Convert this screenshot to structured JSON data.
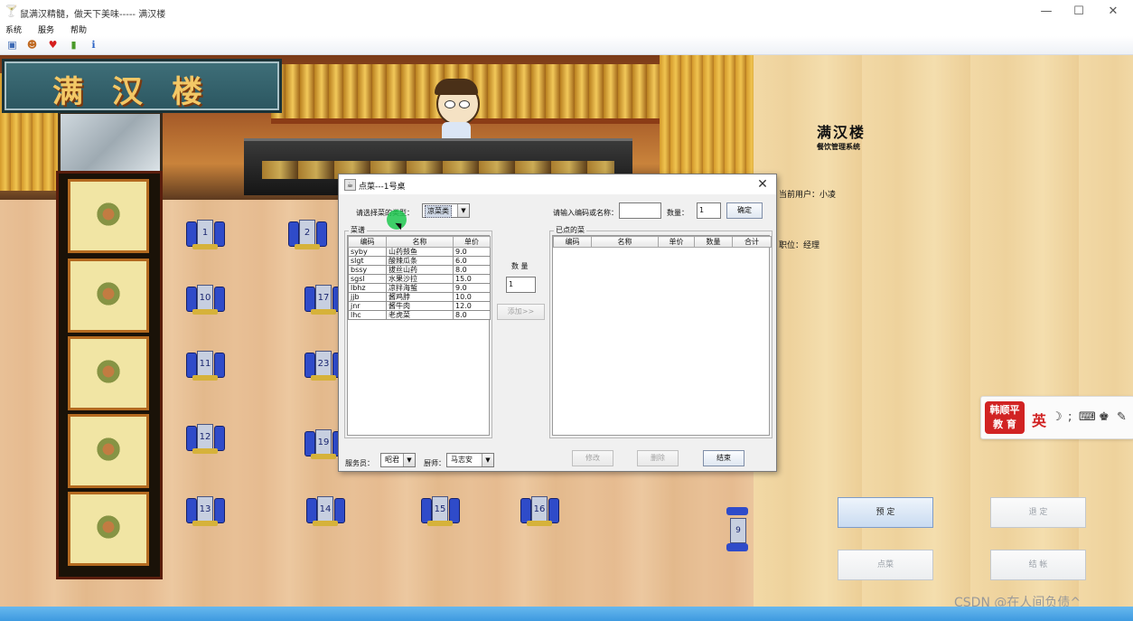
{
  "window": {
    "title": "鼠满汉精髓，做天下美味----- 满汉楼",
    "minimize_glyph": "—",
    "maximize_glyph": "☐",
    "close_glyph": "✕"
  },
  "menu": {
    "items": [
      "系统",
      "服务",
      "帮助"
    ]
  },
  "toolbar_icons": [
    "picture-icon",
    "users-icon",
    "heart-icon",
    "book-icon",
    "info-icon"
  ],
  "restaurant": {
    "sign_text": "满汉楼",
    "tables": [
      {
        "num": "1"
      },
      {
        "num": "2"
      },
      {
        "num": "10"
      },
      {
        "num": "17"
      },
      {
        "num": "11"
      },
      {
        "num": "23"
      },
      {
        "num": "12"
      },
      {
        "num": "19"
      },
      {
        "num": "13"
      },
      {
        "num": "14"
      },
      {
        "num": "15"
      },
      {
        "num": "16"
      }
    ],
    "side_table": "9"
  },
  "right_panel": {
    "logo_title": "满汉楼",
    "logo_subtitle": "餐饮管理系统",
    "current_user": "当前用户：小凌",
    "position": "职位：经理",
    "buttons": {
      "reserve": "预 定",
      "unreserve": "退 定",
      "order": "点菜",
      "checkout": "结 帐"
    }
  },
  "dialog": {
    "title": "点菜---1号桌",
    "close_glyph": "✕",
    "category_label": "请选择菜的类型：",
    "category_value": "凉菜类",
    "search_label": "请输入编码或名称：",
    "search_value": "",
    "qty_label": "数量：",
    "qty_value": "1",
    "confirm_button": "确定",
    "menu_group_title": "菜谱",
    "menu_columns": [
      "编码",
      "名称",
      "单价"
    ],
    "menu_rows": [
      [
        "syby",
        "山药鼓鱼",
        "9.0"
      ],
      [
        "slgt",
        "酸辣瓜条",
        "6.0"
      ],
      [
        "bssy",
        "拔丝山药",
        "8.0"
      ],
      [
        "sgsl",
        "水果沙拉",
        "15.0"
      ],
      [
        "lbhz",
        "凉拌海蜇",
        "9.0"
      ],
      [
        "jjb",
        "酱鸡脖",
        "10.0"
      ],
      [
        "jnr",
        "酱牛肉",
        "12.0"
      ],
      [
        "lhc",
        "老虎菜",
        "8.0"
      ]
    ],
    "middle_qty_label": "数 量",
    "middle_qty_value": "1",
    "add_button": "添加>>",
    "ordered_group_title": "已点的菜",
    "ordered_columns": [
      "编码",
      "名称",
      "单价",
      "数量",
      "合计"
    ],
    "waiter_label": "服务员：",
    "waiter_value": "昭君",
    "cook_label": "厨师：",
    "cook_value": "马志安",
    "modify_button": "修改",
    "delete_button": "删除",
    "finish_button": "结束"
  },
  "ime": {
    "badge_line1": "韩顺平",
    "badge_line2": "教 育",
    "lang": "英"
  },
  "watermark": "CSDN @在人间负债^"
}
